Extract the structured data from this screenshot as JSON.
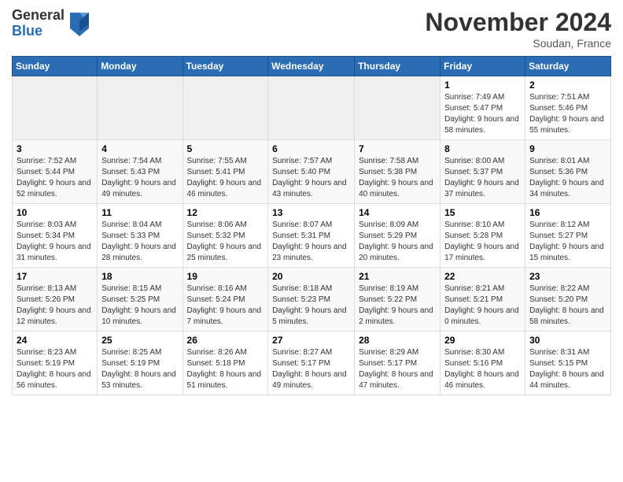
{
  "header": {
    "logo_general": "General",
    "logo_blue": "Blue",
    "month_title": "November 2024",
    "location": "Soudan, France"
  },
  "days_of_week": [
    "Sunday",
    "Monday",
    "Tuesday",
    "Wednesday",
    "Thursday",
    "Friday",
    "Saturday"
  ],
  "weeks": [
    [
      {
        "day": "",
        "info": ""
      },
      {
        "day": "",
        "info": ""
      },
      {
        "day": "",
        "info": ""
      },
      {
        "day": "",
        "info": ""
      },
      {
        "day": "",
        "info": ""
      },
      {
        "day": "1",
        "info": "Sunrise: 7:49 AM\nSunset: 5:47 PM\nDaylight: 9 hours and 58 minutes."
      },
      {
        "day": "2",
        "info": "Sunrise: 7:51 AM\nSunset: 5:46 PM\nDaylight: 9 hours and 55 minutes."
      }
    ],
    [
      {
        "day": "3",
        "info": "Sunrise: 7:52 AM\nSunset: 5:44 PM\nDaylight: 9 hours and 52 minutes."
      },
      {
        "day": "4",
        "info": "Sunrise: 7:54 AM\nSunset: 5:43 PM\nDaylight: 9 hours and 49 minutes."
      },
      {
        "day": "5",
        "info": "Sunrise: 7:55 AM\nSunset: 5:41 PM\nDaylight: 9 hours and 46 minutes."
      },
      {
        "day": "6",
        "info": "Sunrise: 7:57 AM\nSunset: 5:40 PM\nDaylight: 9 hours and 43 minutes."
      },
      {
        "day": "7",
        "info": "Sunrise: 7:58 AM\nSunset: 5:38 PM\nDaylight: 9 hours and 40 minutes."
      },
      {
        "day": "8",
        "info": "Sunrise: 8:00 AM\nSunset: 5:37 PM\nDaylight: 9 hours and 37 minutes."
      },
      {
        "day": "9",
        "info": "Sunrise: 8:01 AM\nSunset: 5:36 PM\nDaylight: 9 hours and 34 minutes."
      }
    ],
    [
      {
        "day": "10",
        "info": "Sunrise: 8:03 AM\nSunset: 5:34 PM\nDaylight: 9 hours and 31 minutes."
      },
      {
        "day": "11",
        "info": "Sunrise: 8:04 AM\nSunset: 5:33 PM\nDaylight: 9 hours and 28 minutes."
      },
      {
        "day": "12",
        "info": "Sunrise: 8:06 AM\nSunset: 5:32 PM\nDaylight: 9 hours and 25 minutes."
      },
      {
        "day": "13",
        "info": "Sunrise: 8:07 AM\nSunset: 5:31 PM\nDaylight: 9 hours and 23 minutes."
      },
      {
        "day": "14",
        "info": "Sunrise: 8:09 AM\nSunset: 5:29 PM\nDaylight: 9 hours and 20 minutes."
      },
      {
        "day": "15",
        "info": "Sunrise: 8:10 AM\nSunset: 5:28 PM\nDaylight: 9 hours and 17 minutes."
      },
      {
        "day": "16",
        "info": "Sunrise: 8:12 AM\nSunset: 5:27 PM\nDaylight: 9 hours and 15 minutes."
      }
    ],
    [
      {
        "day": "17",
        "info": "Sunrise: 8:13 AM\nSunset: 5:26 PM\nDaylight: 9 hours and 12 minutes."
      },
      {
        "day": "18",
        "info": "Sunrise: 8:15 AM\nSunset: 5:25 PM\nDaylight: 9 hours and 10 minutes."
      },
      {
        "day": "19",
        "info": "Sunrise: 8:16 AM\nSunset: 5:24 PM\nDaylight: 9 hours and 7 minutes."
      },
      {
        "day": "20",
        "info": "Sunrise: 8:18 AM\nSunset: 5:23 PM\nDaylight: 9 hours and 5 minutes."
      },
      {
        "day": "21",
        "info": "Sunrise: 8:19 AM\nSunset: 5:22 PM\nDaylight: 9 hours and 2 minutes."
      },
      {
        "day": "22",
        "info": "Sunrise: 8:21 AM\nSunset: 5:21 PM\nDaylight: 9 hours and 0 minutes."
      },
      {
        "day": "23",
        "info": "Sunrise: 8:22 AM\nSunset: 5:20 PM\nDaylight: 8 hours and 58 minutes."
      }
    ],
    [
      {
        "day": "24",
        "info": "Sunrise: 8:23 AM\nSunset: 5:19 PM\nDaylight: 8 hours and 56 minutes."
      },
      {
        "day": "25",
        "info": "Sunrise: 8:25 AM\nSunset: 5:19 PM\nDaylight: 8 hours and 53 minutes."
      },
      {
        "day": "26",
        "info": "Sunrise: 8:26 AM\nSunset: 5:18 PM\nDaylight: 8 hours and 51 minutes."
      },
      {
        "day": "27",
        "info": "Sunrise: 8:27 AM\nSunset: 5:17 PM\nDaylight: 8 hours and 49 minutes."
      },
      {
        "day": "28",
        "info": "Sunrise: 8:29 AM\nSunset: 5:17 PM\nDaylight: 8 hours and 47 minutes."
      },
      {
        "day": "29",
        "info": "Sunrise: 8:30 AM\nSunset: 5:16 PM\nDaylight: 8 hours and 46 minutes."
      },
      {
        "day": "30",
        "info": "Sunrise: 8:31 AM\nSunset: 5:15 PM\nDaylight: 8 hours and 44 minutes."
      }
    ]
  ]
}
